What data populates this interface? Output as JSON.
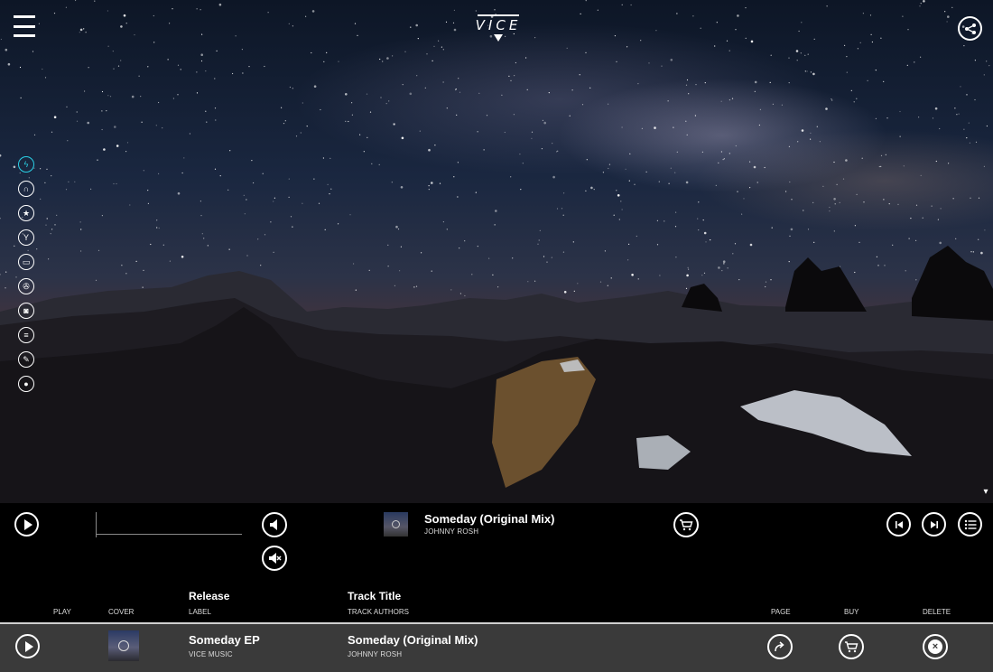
{
  "brand": {
    "logo_text": "VICE"
  },
  "header": {
    "menu_icon": "hamburger-menu-icon",
    "share_icon": "share-icon"
  },
  "sidebar": {
    "items": [
      {
        "icon": "lightning-icon",
        "glyph": "ϟ",
        "active": true
      },
      {
        "icon": "headphones-icon",
        "glyph": "∩",
        "active": false
      },
      {
        "icon": "star-icon",
        "glyph": "★",
        "active": false
      },
      {
        "icon": "cocktail-icon",
        "glyph": "Y",
        "active": false
      },
      {
        "icon": "ticket-icon",
        "glyph": "▭",
        "active": false
      },
      {
        "icon": "film-camera-icon",
        "glyph": "✇",
        "active": false
      },
      {
        "icon": "camera-icon",
        "glyph": "◙",
        "active": false
      },
      {
        "icon": "list-icon",
        "glyph": "≡",
        "active": false
      },
      {
        "icon": "pencil-icon",
        "glyph": "✎",
        "active": false
      },
      {
        "icon": "record-icon",
        "glyph": "●",
        "active": false
      }
    ]
  },
  "player": {
    "now_playing_title": "Someday (Original Mix)",
    "now_playing_artist": "JOHNNY ROSH"
  },
  "table": {
    "headers": {
      "play": "PLAY",
      "cover": "COVER",
      "release": "Release",
      "label": "LABEL",
      "track_title": "Track Title",
      "track_authors": "TRACK AUTHORS",
      "page": "PAGE",
      "buy": "BUY",
      "delete": "DELETE"
    },
    "rows": [
      {
        "release": "Someday EP",
        "label": "VICE MUSIC",
        "track_title": "Someday (Original Mix)",
        "track_authors": "JOHNNY ROSH"
      }
    ]
  },
  "colors": {
    "accent": "#2ad1e6",
    "row_bg": "#3a3a3a",
    "bar_bg": "#000000"
  }
}
